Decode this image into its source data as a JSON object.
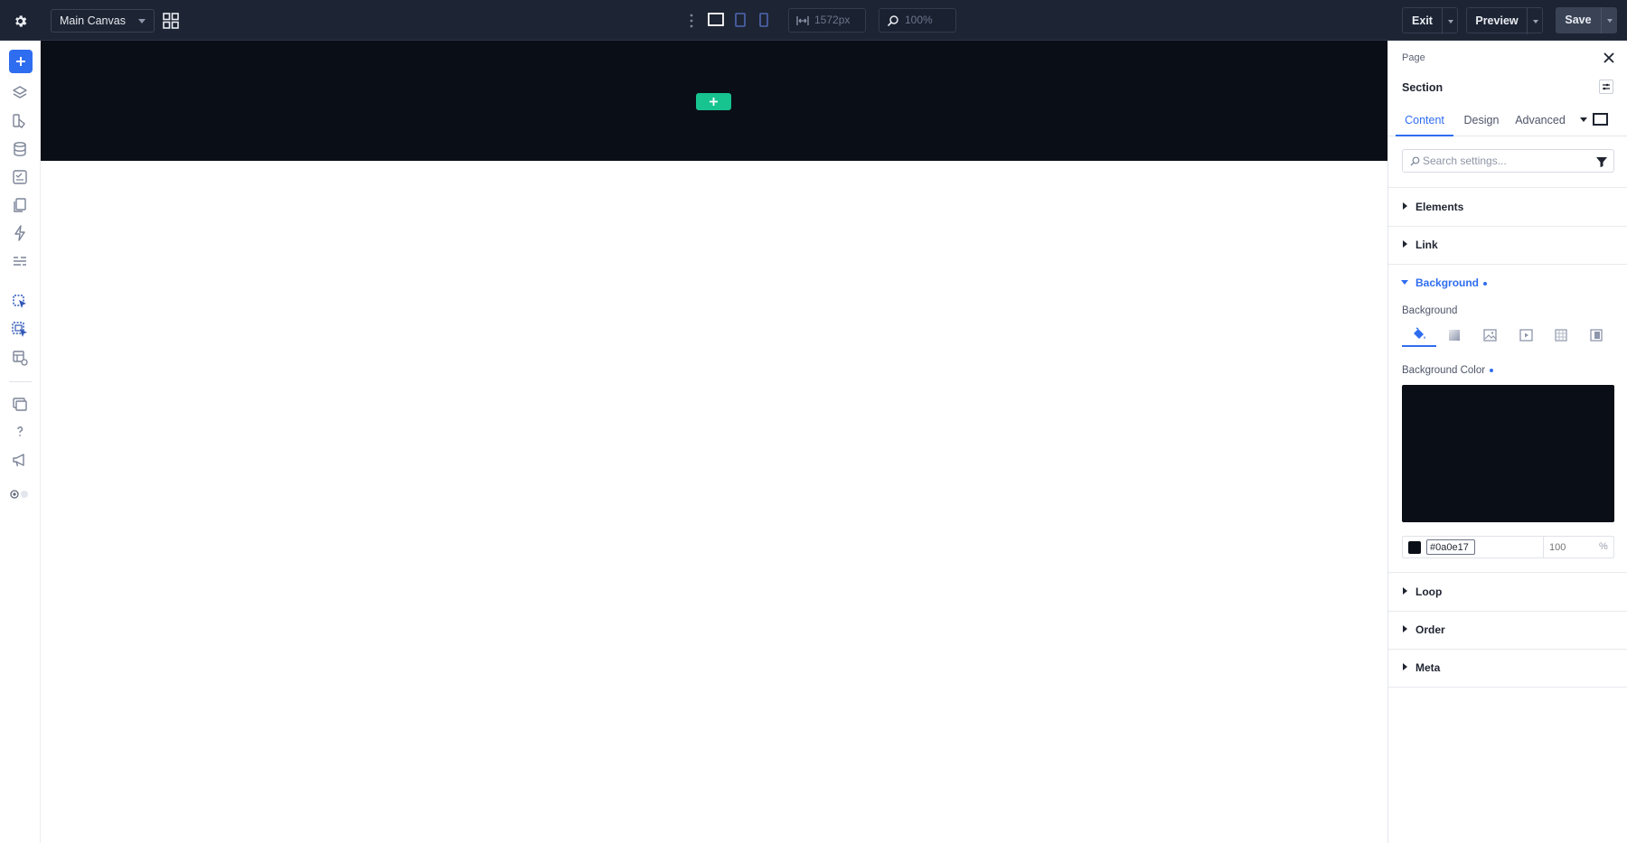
{
  "topbar": {
    "canvas_select": "Main Canvas",
    "width_value": "1572px",
    "zoom_value": "100%",
    "exit_label": "Exit",
    "preview_label": "Preview",
    "save_label": "Save"
  },
  "panel": {
    "breadcrumb": "Page",
    "title": "Section",
    "tabs": [
      "Content",
      "Design",
      "Advanced"
    ],
    "active_tab": "Content",
    "search_placeholder": "Search settings...",
    "sections": {
      "elements": "Elements",
      "link": "Link",
      "background": "Background",
      "loop": "Loop",
      "order": "Order",
      "meta": "Meta"
    },
    "background": {
      "type_label": "Background",
      "color_label": "Background Color",
      "color_hex": "#0a0e17",
      "opacity_placeholder": "100",
      "opacity_unit": "%"
    }
  },
  "colors": {
    "topbar": "#1d2433",
    "accent": "#2f6df0",
    "section_bg": "#0a0e17",
    "add_green": "#17c38f"
  }
}
